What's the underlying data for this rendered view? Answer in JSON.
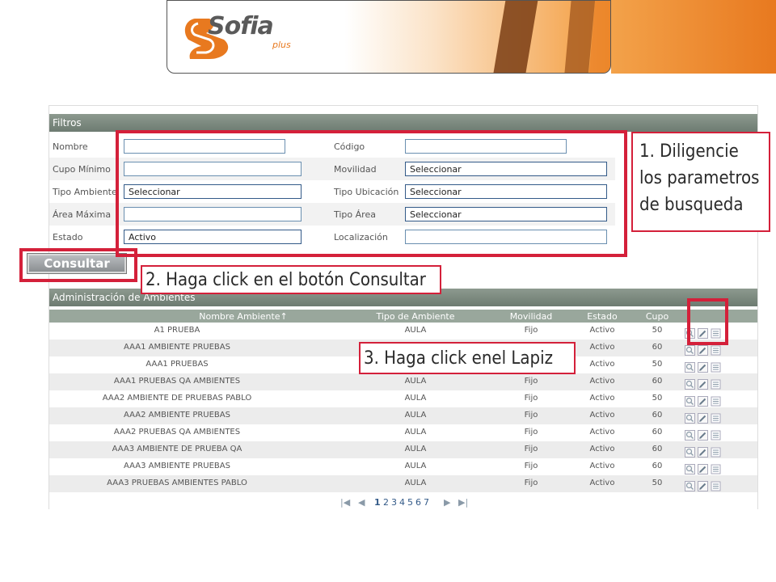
{
  "header": {
    "logo_text": "Sofia",
    "logo_sub": "plus"
  },
  "filters": {
    "title": "Filtros",
    "fields": {
      "nombre": {
        "label": "Nombre",
        "value": ""
      },
      "codigo": {
        "label": "Código",
        "value": ""
      },
      "cupo_minimo": {
        "label": "Cupo Mínimo",
        "value": ""
      },
      "movilidad": {
        "label": "Movilidad",
        "value": "Seleccionar"
      },
      "tipo_ambiente": {
        "label": "Tipo Ambiente",
        "value": "Seleccionar"
      },
      "tipo_ubicacion": {
        "label": "Tipo Ubicación",
        "value": "Seleccionar"
      },
      "area_maxima": {
        "label": "Área Máxima",
        "value": ""
      },
      "tipo_area": {
        "label": "Tipo Área",
        "value": "Seleccionar"
      },
      "estado": {
        "label": "Estado",
        "value": "Activo"
      },
      "localizacion": {
        "label": "Localización",
        "value": ""
      }
    },
    "consult_button": "Consultar"
  },
  "admin": {
    "title": "Administración de Ambientes",
    "columns": {
      "nombre": "Nombre Ambiente↑",
      "tipo": "Tipo de Ambiente",
      "movilidad": "Movilidad",
      "estado": "Estado",
      "cupo": "Cupo"
    },
    "rows": [
      {
        "nombre": "A1 PRUEBA",
        "tipo": "AULA",
        "movilidad": "Fijo",
        "estado": "Activo",
        "cupo": "50"
      },
      {
        "nombre": "AAA1 AMBIENTE PRUEBAS",
        "tipo": "",
        "movilidad": "",
        "estado": "Activo",
        "cupo": "60"
      },
      {
        "nombre": "AAA1 PRUEBAS",
        "tipo": "",
        "movilidad": "",
        "estado": "Activo",
        "cupo": "50"
      },
      {
        "nombre": "AAA1 PRUEBAS QA AMBIENTES",
        "tipo": "AULA",
        "movilidad": "Fijo",
        "estado": "Activo",
        "cupo": "60"
      },
      {
        "nombre": "AAA2 AMBIENTE DE PRUEBAS PABLO",
        "tipo": "AULA",
        "movilidad": "Fijo",
        "estado": "Activo",
        "cupo": "50"
      },
      {
        "nombre": "AAA2 AMBIENTE PRUEBAS",
        "tipo": "AULA",
        "movilidad": "Fijo",
        "estado": "Activo",
        "cupo": "60"
      },
      {
        "nombre": "AAA2 PRUEBAS QA AMBIENTES",
        "tipo": "AULA",
        "movilidad": "Fijo",
        "estado": "Activo",
        "cupo": "60"
      },
      {
        "nombre": "AAA3 AMBIENTE DE PRUEBA QA",
        "tipo": "AULA",
        "movilidad": "Fijo",
        "estado": "Activo",
        "cupo": "60"
      },
      {
        "nombre": "AAA3 AMBIENTE PRUEBAS",
        "tipo": "AULA",
        "movilidad": "Fijo",
        "estado": "Activo",
        "cupo": "60"
      },
      {
        "nombre": "AAA3 PRUEBAS AMBIENTES PABLO",
        "tipo": "AULA",
        "movilidad": "Fijo",
        "estado": "Activo",
        "cupo": "50"
      }
    ],
    "pager": {
      "first": "|◀",
      "prev": "◀",
      "pages": [
        "1",
        "2",
        "3",
        "4",
        "5",
        "6",
        "7"
      ],
      "next": "▶",
      "last": "▶|"
    }
  },
  "annotations": {
    "step1": "1. Diligencie los parametros de busqueda",
    "step2": "2. Haga click en el botón Consultar",
    "step3": "3. Haga click enel Lapiz"
  },
  "colors": {
    "accent_red": "#d4203a",
    "header_gray": "#7a887d",
    "brand_orange": "#e8791f"
  }
}
